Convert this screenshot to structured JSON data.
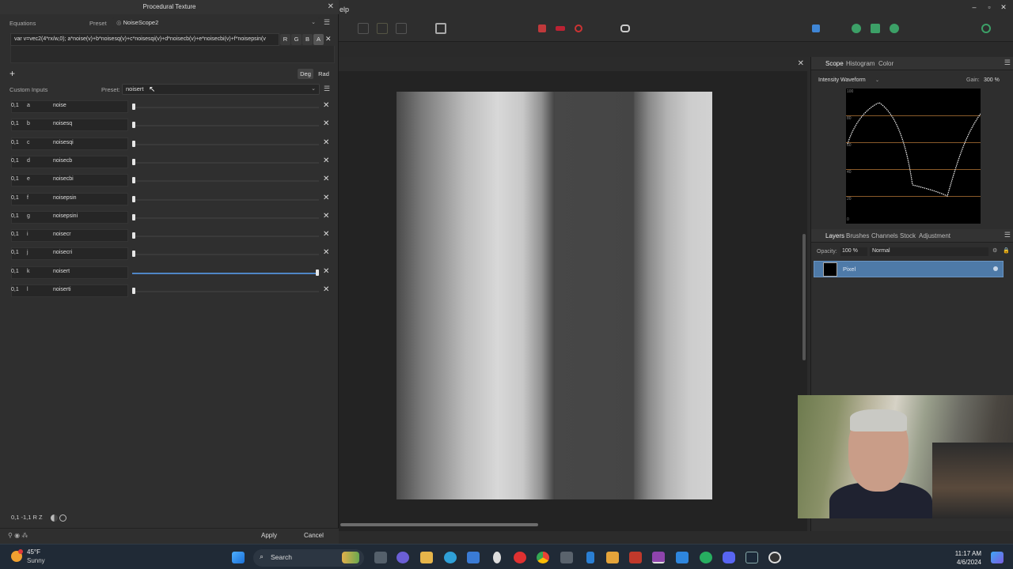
{
  "dialog": {
    "title": "Procedural Texture",
    "equations_label": "Equations",
    "preset_label": "Preset",
    "preset_value": "NoiseScope2",
    "equation": "var v=vec2(4*rx/w,0); a*noise(v)+b*noisesq(v)+c*noisesqi(v)+d*noisecb(v)+e*noisecbi(v)+f*noisepsin(v",
    "channels": [
      "R",
      "G",
      "B",
      "A"
    ],
    "add_symbol": "+",
    "deg_label": "Deg",
    "rad_label": "Rad",
    "custom_inputs_label": "Custom Inputs",
    "custom_preset_label": "Preset:",
    "custom_preset_value": "noisert",
    "inputs": [
      {
        "range": "0,1",
        "var": "a",
        "name": "noise",
        "value": 0.0
      },
      {
        "range": "0,1",
        "var": "b",
        "name": "noisesq",
        "value": 0.0
      },
      {
        "range": "0,1",
        "var": "c",
        "name": "noisesqi",
        "value": 0.0
      },
      {
        "range": "0,1",
        "var": "d",
        "name": "noisecb",
        "value": 0.0
      },
      {
        "range": "0,1",
        "var": "e",
        "name": "noisecbi",
        "value": 0.0
      },
      {
        "range": "0,1",
        "var": "f",
        "name": "noisepsin",
        "value": 0.0
      },
      {
        "range": "0,1",
        "var": "g",
        "name": "noisepsini",
        "value": 0.0
      },
      {
        "range": "0,1",
        "var": "i",
        "name": "noisecr",
        "value": 0.0
      },
      {
        "range": "0,1",
        "var": "j",
        "name": "noisecri",
        "value": 0.0
      },
      {
        "range": "0,1",
        "var": "k",
        "name": "noisert",
        "value": 1.0
      },
      {
        "range": "0,1",
        "var": "l",
        "name": "noiserti",
        "value": 0.0
      }
    ],
    "bottom_tools": "0,1  -1,1  R  Z",
    "apply_label": "Apply",
    "cancel_label": "Cancel"
  },
  "app": {
    "menu_fragment": "elp"
  },
  "studio": {
    "scope_tabs": [
      "Scope",
      "Histogram",
      "Color"
    ],
    "scope_mode": "Intensity Waveform",
    "gain_label": "Gain:",
    "gain_value": "300 %",
    "scope_ticks": [
      "100",
      "80",
      "60",
      "40",
      "20",
      "0"
    ],
    "layer_tabs": [
      "Layers",
      "Brushes",
      "Channels",
      "Stock",
      "Adjustment"
    ],
    "opacity_label": "Opacity:",
    "opacity_value": "100 %",
    "blend_mode": "Normal",
    "layer_name": "Pixel"
  },
  "taskbar": {
    "temperature": "45°F",
    "weather": "Sunny",
    "search_label": "Search",
    "time": "11:17 AM",
    "date": "4/6/2024"
  },
  "colors": {
    "accent": "#4f86c6",
    "layer_selected": "#4e7aa8",
    "scope_line": "#8a5a2a"
  }
}
